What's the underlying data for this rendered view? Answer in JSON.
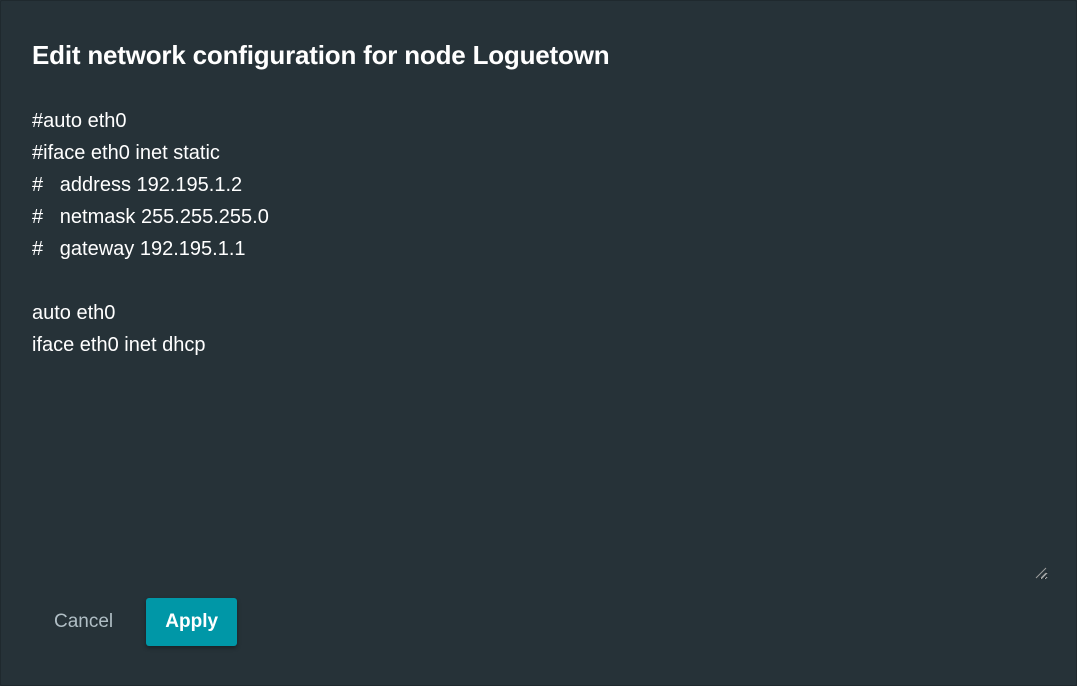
{
  "dialog": {
    "title": "Edit network configuration for node Loguetown",
    "config_text": "#auto eth0\n#iface eth0 inet static\n#\taddress 192.195.1.2\n#\tnetmask 255.255.255.0\n#\tgateway 192.195.1.1\n\nauto eth0\niface eth0 inet dhcp",
    "cancel_label": "Cancel",
    "apply_label": "Apply"
  },
  "colors": {
    "background": "#263238",
    "text": "#ffffff",
    "accent": "#0097a7",
    "muted": "#b0bec5"
  }
}
